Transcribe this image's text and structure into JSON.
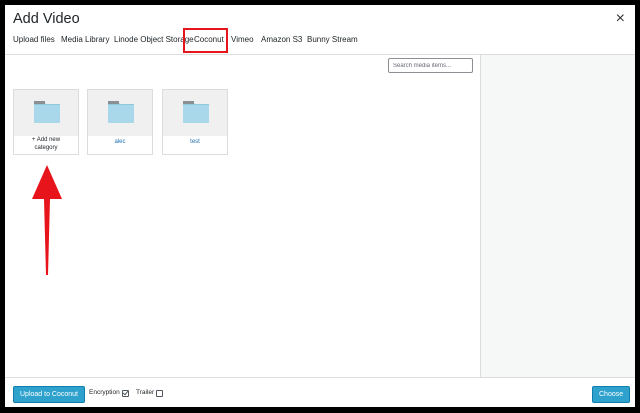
{
  "dialog": {
    "title": "Add Video",
    "close_label": "×"
  },
  "tabs": [
    {
      "label": "Upload files"
    },
    {
      "label": "Media Library"
    },
    {
      "label": "Linode Object Storage"
    },
    {
      "label": "Coconut"
    },
    {
      "label": "Vimeo"
    },
    {
      "label": "Amazon S3"
    },
    {
      "label": "Bunny Stream"
    }
  ],
  "active_tab": "Coconut",
  "search": {
    "placeholder": "Search media items...",
    "value": ""
  },
  "folders": [
    {
      "label_line1": "+ Add new",
      "label_line2": "category",
      "icon": "folder-icon"
    },
    {
      "label": "alec",
      "icon": "folder-icon"
    },
    {
      "label": "test",
      "icon": "folder-icon"
    }
  ],
  "footer": {
    "upload_label": "Upload to Coconut",
    "encryption_label": "Encryption",
    "encryption_checked": true,
    "trailer_label": "Trailer",
    "trailer_checked": false,
    "choose_label": "Choose"
  },
  "colors": {
    "primary_button": "#2ea2cc",
    "highlight": "#e8141b",
    "folder": "#9fd3e6",
    "link": "#2271b1"
  }
}
